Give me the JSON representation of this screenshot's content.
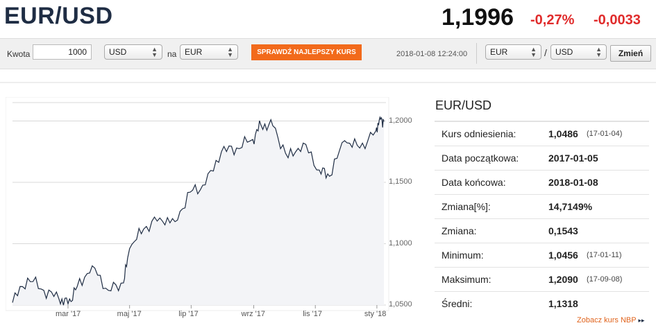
{
  "header": {
    "pair": "EUR/USD",
    "rate": "1,1996",
    "change_pct": "-0,27%",
    "change_abs": "-0,0033"
  },
  "converter": {
    "amount_label": "Kwota",
    "amount_value": "1000",
    "from_currency": "USD",
    "na_label": "na",
    "to_currency": "EUR",
    "cta_label": "SPRAWDŹ NAJLEPSZY KURS",
    "timestamp": "2018-01-08 12:24:00",
    "pair_base": "EUR",
    "slash": "/",
    "pair_quote": "USD",
    "change_button": "Zmień"
  },
  "colors": {
    "accent_orange": "#f26a1b",
    "negative_red": "#e02b2b",
    "line_navy": "#1f2d44"
  },
  "chart_data": {
    "type": "area",
    "yticks": [
      "1,2000",
      "1,1500",
      "1,1000",
      "1,0500"
    ],
    "xticks": [
      "mar '17",
      "maj '17",
      "lip '17",
      "wrz '17",
      "lis '17",
      "sty '18"
    ],
    "ylim": [
      1.05,
      1.2
    ],
    "grid": true,
    "x_dates": [
      "2017-01-05",
      "2017-01-20",
      "2017-02-05",
      "2017-02-20",
      "2017-03-01",
      "2017-03-10",
      "2017-03-25",
      "2017-04-10",
      "2017-04-25",
      "2017-05-01",
      "2017-05-15",
      "2017-05-31",
      "2017-06-15",
      "2017-06-30",
      "2017-07-15",
      "2017-07-31",
      "2017-08-15",
      "2017-08-31",
      "2017-09-08",
      "2017-09-20",
      "2017-10-05",
      "2017-10-20",
      "2017-11-05",
      "2017-11-15",
      "2017-11-30",
      "2017-12-15",
      "2017-12-31",
      "2018-01-04",
      "2018-01-08"
    ],
    "values": [
      1.052,
      1.072,
      1.062,
      1.055,
      1.051,
      1.065,
      1.082,
      1.062,
      1.068,
      1.096,
      1.112,
      1.121,
      1.118,
      1.142,
      1.148,
      1.175,
      1.178,
      1.185,
      1.197,
      1.196,
      1.17,
      1.182,
      1.16,
      1.155,
      1.184,
      1.178,
      1.192,
      1.203,
      1.1996
    ]
  },
  "stats": {
    "title": "EUR/USD",
    "rows": [
      {
        "label": "Kurs odniesienia:",
        "value": "1,0486",
        "date": "(17-01-04)"
      },
      {
        "label": "Data początkowa:",
        "value": "2017-01-05",
        "date": ""
      },
      {
        "label": "Data końcowa:",
        "value": "2018-01-08",
        "date": ""
      },
      {
        "label": "Zmiana[%]:",
        "value": "14,7149%",
        "date": ""
      },
      {
        "label": "Zmiana:",
        "value": "0,1543",
        "date": ""
      },
      {
        "label": "Minimum:",
        "value": "1,0456",
        "date": "(17-01-11)"
      },
      {
        "label": "Maksimum:",
        "value": "1,2090",
        "date": "(17-09-08)"
      },
      {
        "label": "Średni:",
        "value": "1,1318",
        "date": ""
      }
    ]
  },
  "footer": {
    "nbp_link": "Zobacz kurs NBP",
    "nbp_arrow": "▸▸"
  }
}
